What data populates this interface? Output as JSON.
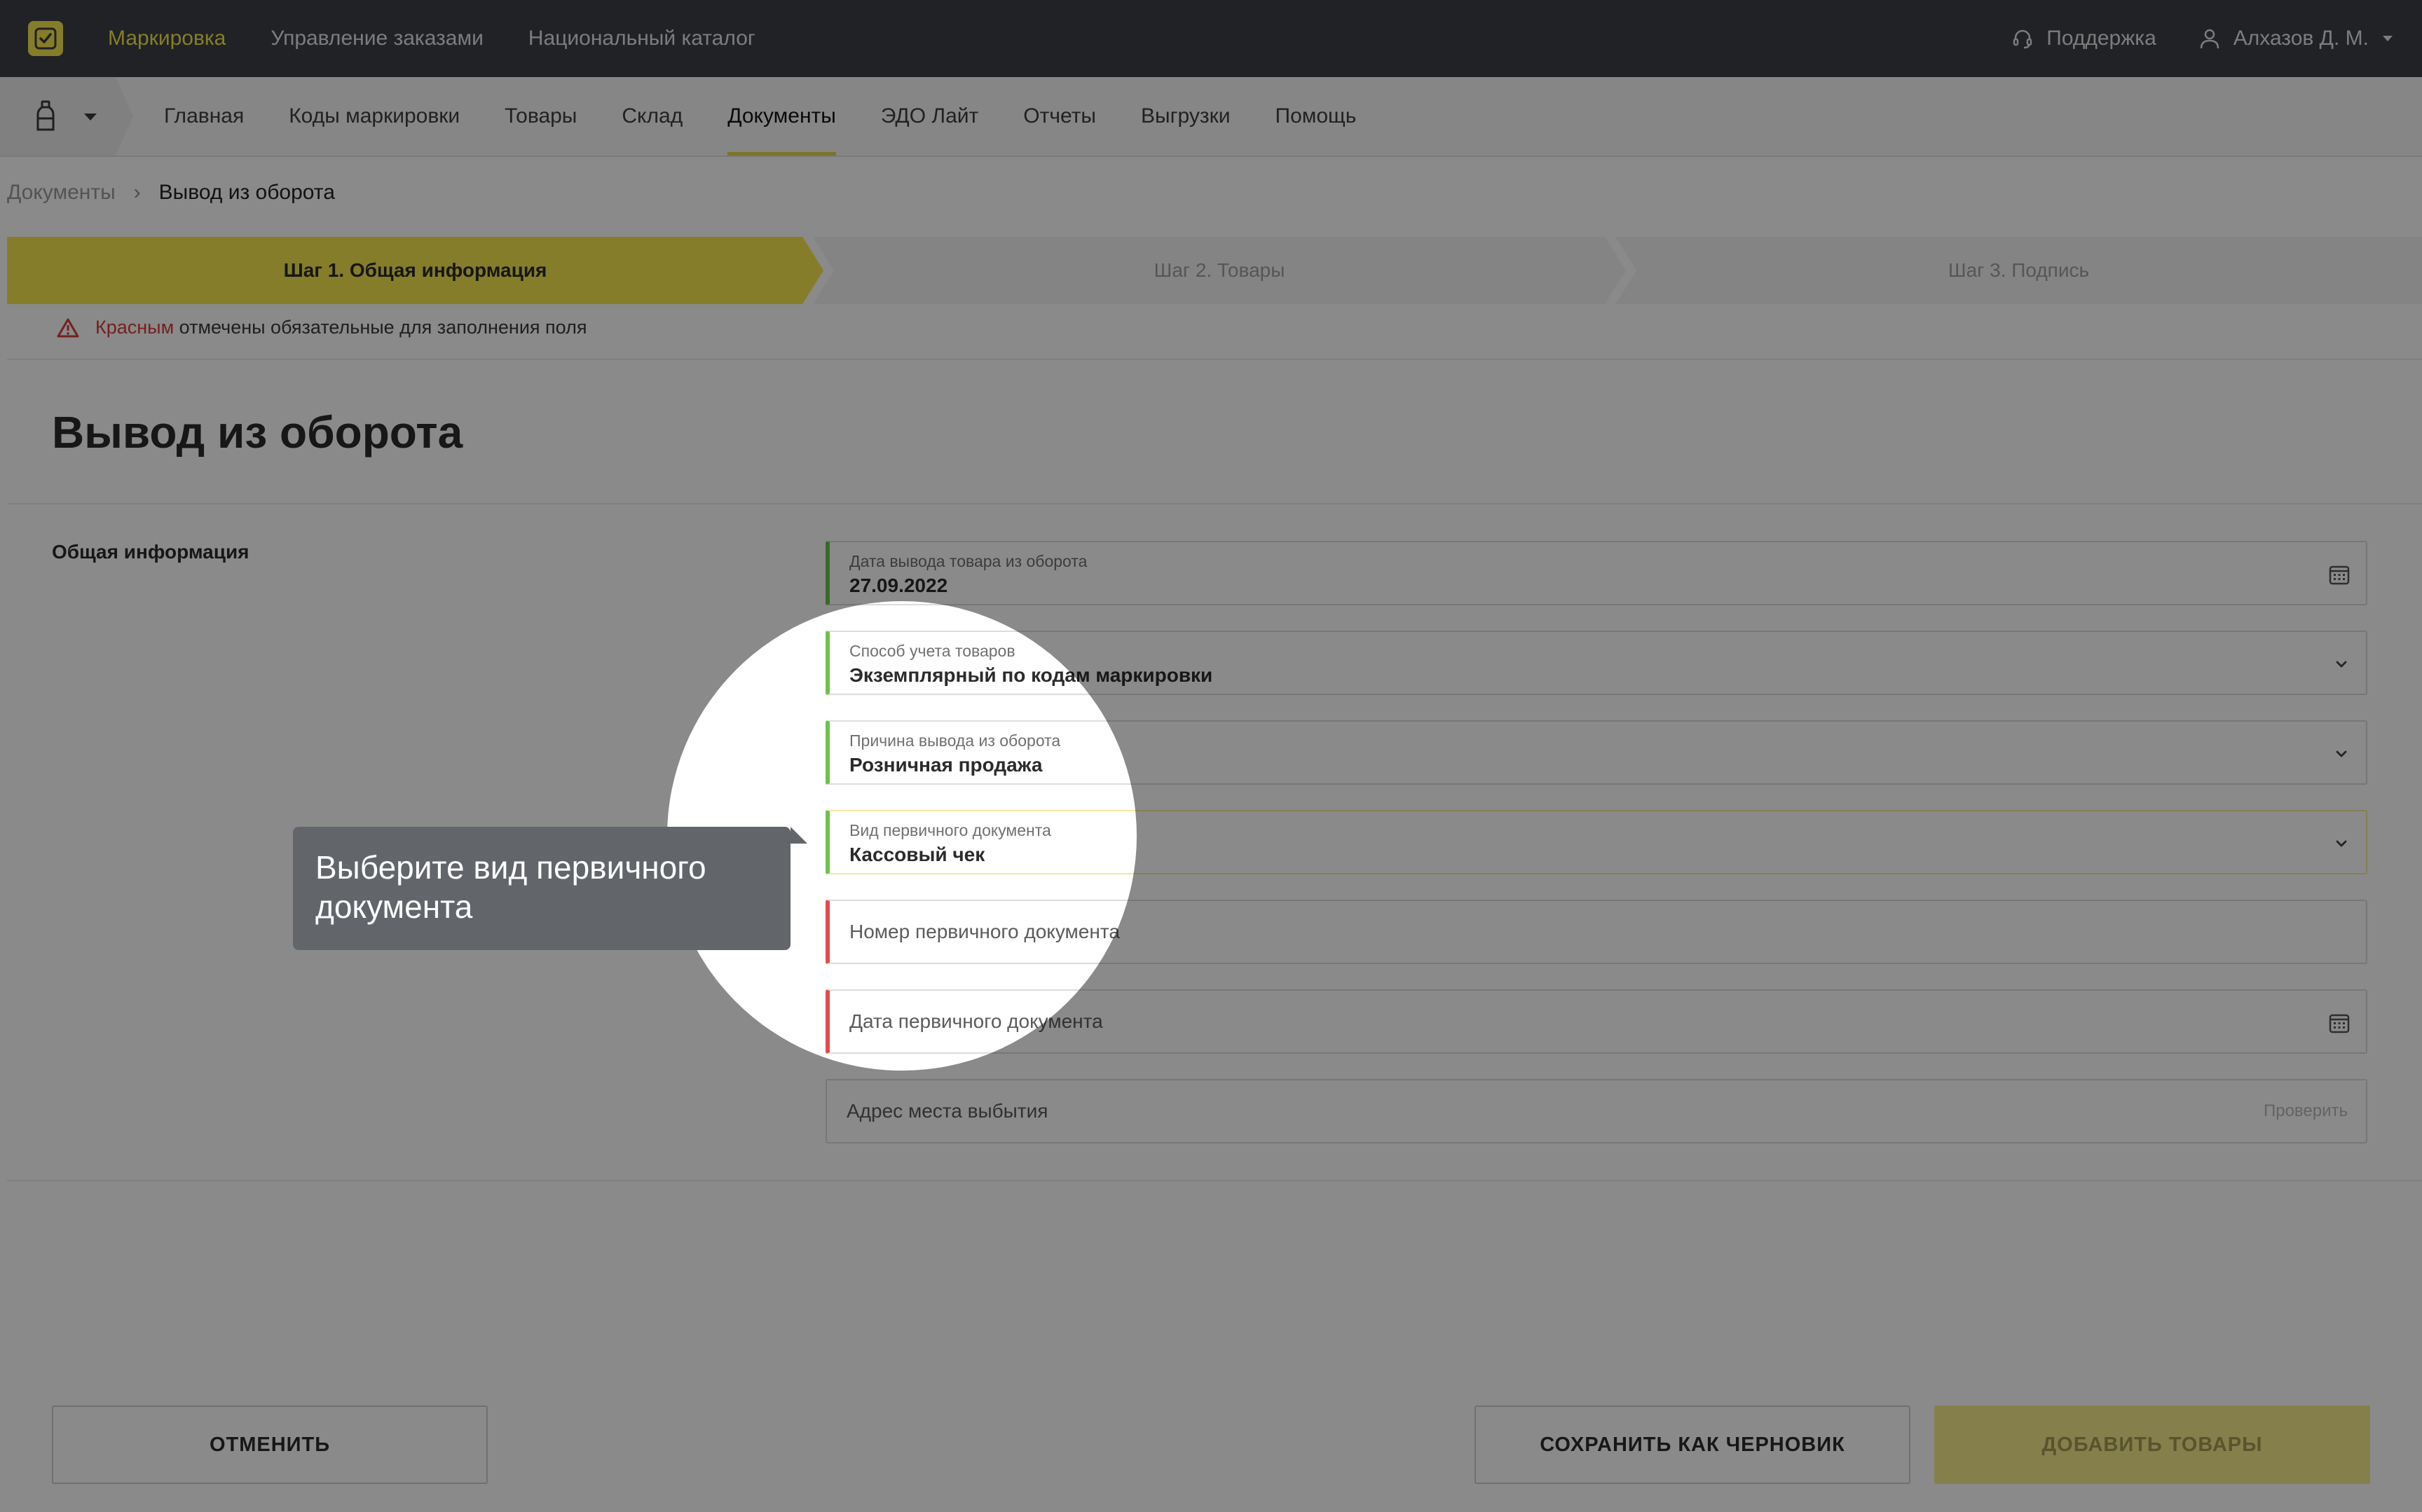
{
  "topbar": {
    "nav": [
      {
        "label": "Маркировка",
        "active": true
      },
      {
        "label": "Управление заказами",
        "active": false
      },
      {
        "label": "Национальный каталог",
        "active": false
      }
    ],
    "support_label": "Поддержка",
    "user_label": "Алхазов Д. М."
  },
  "subnav": {
    "items": [
      {
        "label": "Главная"
      },
      {
        "label": "Коды маркировки"
      },
      {
        "label": "Товары"
      },
      {
        "label": "Склад"
      },
      {
        "label": "Документы",
        "active": true
      },
      {
        "label": "ЭДО Лайт"
      },
      {
        "label": "Отчеты"
      },
      {
        "label": "Выгрузки"
      },
      {
        "label": "Помощь"
      }
    ]
  },
  "breadcrumb": {
    "parent": "Документы",
    "separator": "›",
    "current": "Вывод из оборота"
  },
  "steps": [
    {
      "label": "Шаг 1. Общая информация",
      "active": true
    },
    {
      "label": "Шаг 2. Товары",
      "active": false
    },
    {
      "label": "Шаг 3. Подпись",
      "active": false
    }
  ],
  "notice": {
    "red_word": "Красным",
    "rest": "отмечены обязательные для заполнения поля"
  },
  "page": {
    "title": "Вывод из оборота",
    "section_label": "Общая информация"
  },
  "form": {
    "date_out": {
      "label": "Дата вывода товара из оборота",
      "value": "27.09.2022"
    },
    "accounting": {
      "label": "Способ учета товаров",
      "value": "Экземплярный по кодам маркировки"
    },
    "reason": {
      "label": "Причина вывода из оборота",
      "value": "Розничная продажа"
    },
    "doc_type": {
      "label": "Вид первичного документа",
      "value": "Кассовый чек"
    },
    "doc_number": {
      "placeholder": "Номер первичного документа"
    },
    "doc_date": {
      "placeholder": "Дата первичного документа"
    },
    "address": {
      "placeholder": "Адрес места выбытия",
      "check_label": "Проверить"
    }
  },
  "buttons": {
    "cancel": "ОТМЕНИТЬ",
    "draft": "СОХРАНИТЬ КАК ЧЕРНОВИК",
    "add": "ДОБАВИТЬ ТОВАРЫ"
  },
  "tooltip": {
    "text": "Выберите вид первичного документа"
  },
  "colors": {
    "accent": "#f5e84d",
    "topbar": "#3b3f47",
    "valid": "#6cc24a",
    "required": "#e24b4b"
  }
}
